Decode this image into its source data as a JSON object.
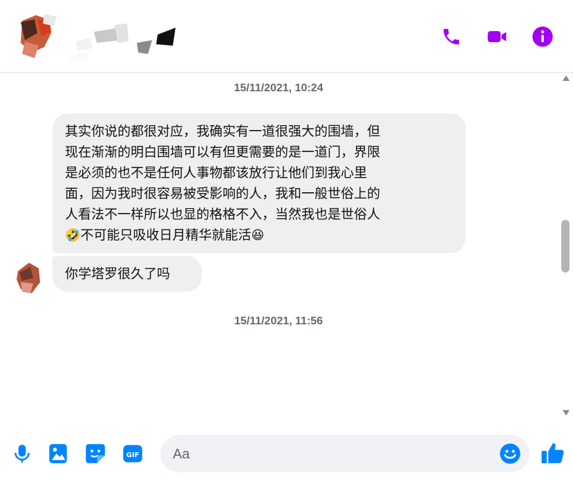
{
  "header": {
    "icons": [
      "phone-icon",
      "video-icon",
      "info-icon"
    ],
    "accent_color": "#a100f2"
  },
  "messages": {
    "timestamp_1": "15/11/2021, 10:24",
    "bubble_1_lines": [
      "其实你说的都很对应，我确实有一道很强大的围墙，但",
      "现在渐渐的明白围墙可以有但更需要的是一道门，界限",
      "是必须的也不是任何人事物都该放行让他们到我心里",
      "面，因为我时很容易被受影响的人，我和一般世俗上的",
      "人看法不一样所以也显的格格不入，当然我也是世俗人"
    ],
    "bubble_1_last": {
      "emoji_start": "🤣",
      "text": "不可能只吸收日月精华就能活",
      "emoji_end": "😆"
    },
    "bubble_2": "你学塔罗很久了吗",
    "timestamp_2": "15/11/2021, 11:56"
  },
  "composer": {
    "placeholder": "Aa",
    "accent_color": "#0084ff",
    "icons": [
      "microphone-icon",
      "image-icon",
      "sticker-icon",
      "gif-icon",
      "emoji-icon",
      "thumbs-up-icon"
    ],
    "gif_label": "GIF"
  }
}
